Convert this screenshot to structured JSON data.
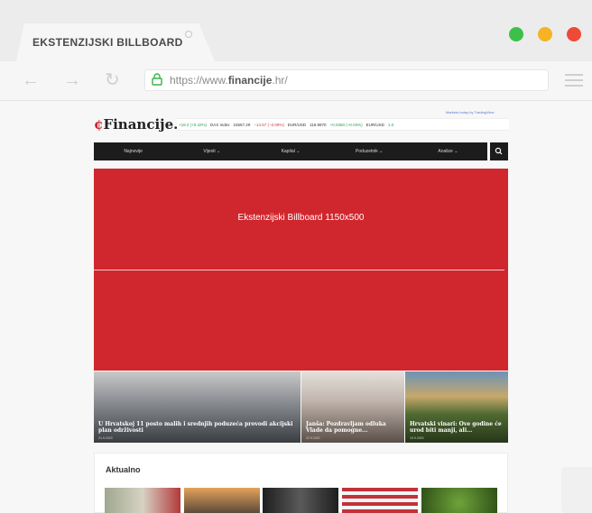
{
  "browser": {
    "tab_title": "EKSTENZIJSKI BILLBOARD",
    "url_prefix": "https://www.",
    "url_domain": "financije",
    "url_suffix": ".hr/",
    "window_dots": [
      "#3cc04a",
      "#f6b324",
      "#ef4a37"
    ]
  },
  "site": {
    "logo": "Financije.hr",
    "markets_label": "Markets today by TradingView",
    "ticker": [
      {
        "text": "+18.2 (+0.42%)",
        "trend": "up"
      },
      {
        "text": "DAX Index",
        "trend": "none"
      },
      {
        "text": "15557.29",
        "trend": "none"
      },
      {
        "text": "−14.57 (−0.09%)",
        "trend": "down"
      },
      {
        "text": "EUR/USD",
        "trend": "none"
      },
      {
        "text": "116.9870",
        "trend": "none"
      },
      {
        "text": "+0.0360 (+0.03%)",
        "trend": "up"
      },
      {
        "text": "EUR/USD",
        "trend": "none"
      },
      {
        "text": "1.0",
        "trend": "up"
      }
    ],
    "nav": [
      "Najnovije",
      "Vijesti ⌄",
      "Kapital ⌄",
      "Poduzetnik ⌄",
      "Analize ⌄"
    ],
    "billboard_label": "Ekstenzijski Billboard 1150x500",
    "tiles": [
      {
        "caption": "U Hrvatskoj 11 posto malih i srednjih poduzeća provodi akcijski plan održivosti",
        "date": "21.9.2023"
      },
      {
        "caption": "Janša: Pozdravljam odluka Vlade da pomogne...",
        "date": "22.9.2020"
      },
      {
        "caption": "Hrvatski vinari: Ove godine će urod biti manji, ali...",
        "date": "19.9.2020"
      }
    ],
    "section_title": "Aktualno"
  },
  "colors": {
    "accent_red": "#d0262d",
    "nav_bg": "#1c1c1c"
  }
}
